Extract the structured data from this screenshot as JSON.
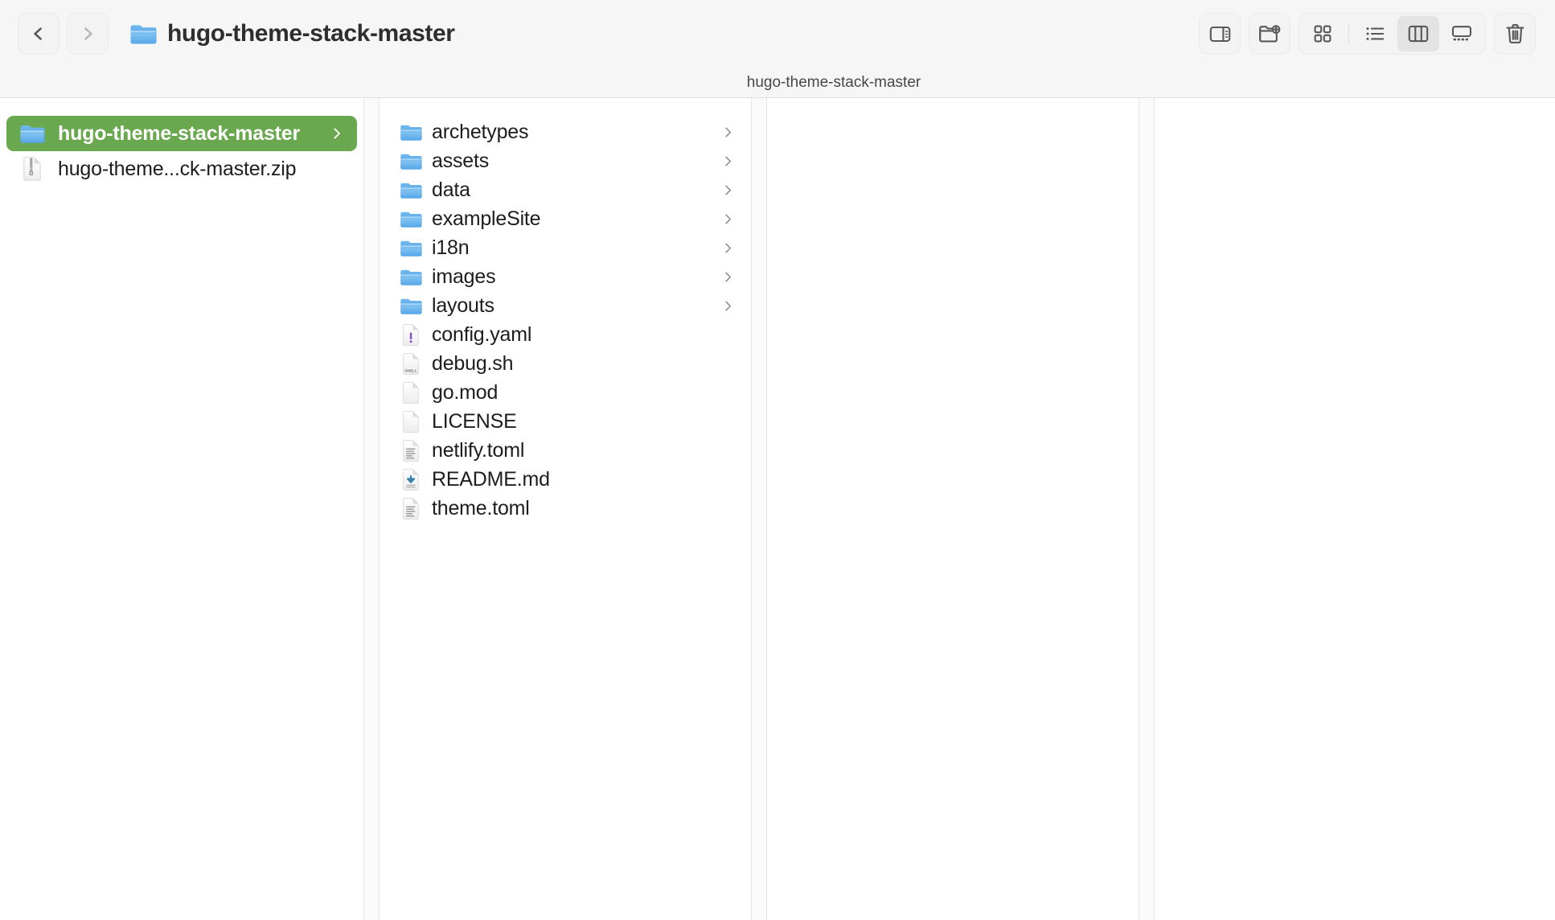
{
  "window": {
    "title": "hugo-theme-stack-master",
    "title_icon": "folder-icon"
  },
  "toolbar": {
    "back_label": "Back",
    "back_icon": "chevron-left-icon",
    "forward_label": "Forward",
    "forward_icon": "chevron-right-icon",
    "sidebar_toggle_label": "Toggle Sidebar",
    "sidebar_toggle_icon": "sidebar-panel-icon",
    "new_folder_label": "New Folder",
    "new_folder_icon": "new-folder-plus-icon",
    "view_icon_label": "Icon View",
    "view_icon_icon": "grid-view-icon",
    "view_list_label": "List View",
    "view_list_icon": "list-view-icon",
    "view_column_label": "Column View",
    "view_column_icon": "column-view-icon",
    "view_gallery_label": "Gallery View",
    "view_gallery_icon": "gallery-view-icon",
    "active_view": "column",
    "trash_label": "Move to Trash",
    "trash_icon": "trash-icon"
  },
  "pathbar": {
    "current": "hugo-theme-stack-master"
  },
  "sidebar": {
    "items": [
      {
        "name": "hugo-theme-stack-master",
        "icon": "folder-icon",
        "selected": true,
        "has_disclosure": true
      },
      {
        "name": "hugo-theme...ck-master.zip",
        "icon": "zip-archive-icon",
        "selected": false,
        "has_disclosure": false
      }
    ]
  },
  "contents": {
    "items": [
      {
        "name": "archetypes",
        "icon": "folder-icon",
        "kind": "folder",
        "has_disclosure": true
      },
      {
        "name": "assets",
        "icon": "folder-icon",
        "kind": "folder",
        "has_disclosure": true
      },
      {
        "name": "data",
        "icon": "folder-icon",
        "kind": "folder",
        "has_disclosure": true
      },
      {
        "name": "exampleSite",
        "icon": "folder-icon",
        "kind": "folder",
        "has_disclosure": true
      },
      {
        "name": "i18n",
        "icon": "folder-icon",
        "kind": "folder",
        "has_disclosure": true
      },
      {
        "name": "images",
        "icon": "folder-icon",
        "kind": "folder",
        "has_disclosure": true
      },
      {
        "name": "layouts",
        "icon": "folder-icon",
        "kind": "folder",
        "has_disclosure": true
      },
      {
        "name": "config.yaml",
        "icon": "yaml-document-icon",
        "kind": "file",
        "has_disclosure": false
      },
      {
        "name": "debug.sh",
        "icon": "shell-script-icon",
        "kind": "file",
        "has_disclosure": false
      },
      {
        "name": "go.mod",
        "icon": "blank-document-icon",
        "kind": "file",
        "has_disclosure": false
      },
      {
        "name": "LICENSE",
        "icon": "blank-document-icon",
        "kind": "file",
        "has_disclosure": false
      },
      {
        "name": "netlify.toml",
        "icon": "text-document-icon",
        "kind": "file",
        "has_disclosure": false
      },
      {
        "name": "README.md",
        "icon": "markdown-document-icon",
        "kind": "file",
        "has_disclosure": false
      },
      {
        "name": "theme.toml",
        "icon": "text-document-icon",
        "kind": "file",
        "has_disclosure": false
      }
    ]
  },
  "shell_badge_text": "SHELL",
  "colors": {
    "selection_green": "#69a84f",
    "folder_blue": "#5aaceb",
    "window_chrome": "#f6f6f6",
    "content_background": "#ffffff",
    "text_primary": "#1d1d1f",
    "yaml_accent": "#8c4fc4",
    "markdown_accent": "#3b7fae"
  }
}
